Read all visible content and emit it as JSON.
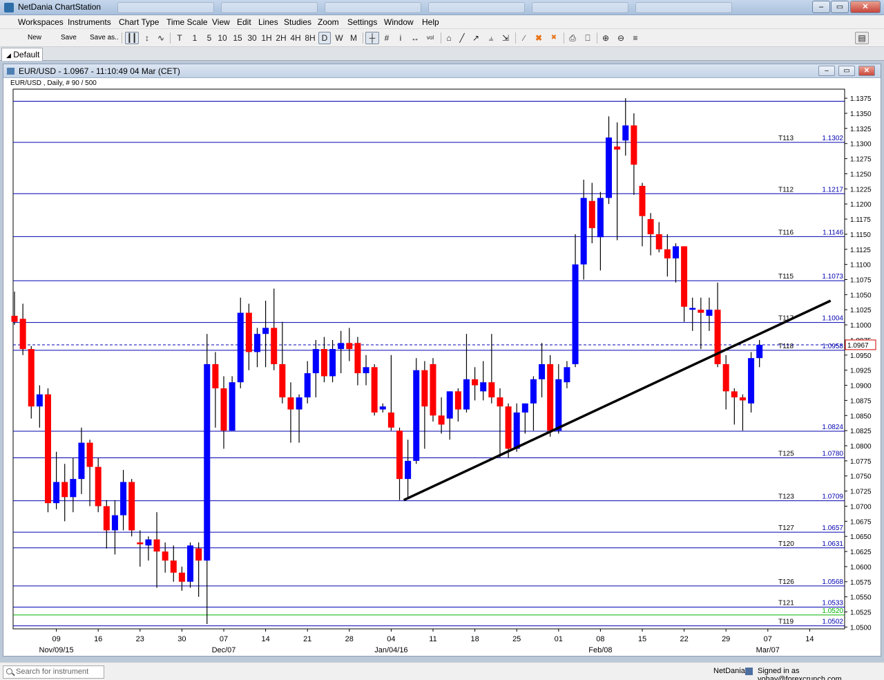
{
  "window": {
    "title": "NetDania ChartStation",
    "buttons": {
      "minimize": "–",
      "maximize": "▭",
      "close": "✕"
    }
  },
  "menu": [
    "Workspaces",
    "Instruments",
    "Chart Type",
    "Time Scale",
    "View",
    "Edit",
    "Lines",
    "Studies",
    "Zoom",
    "Settings",
    "Window",
    "Help"
  ],
  "toolbar": {
    "new_label": "New",
    "save_label": "Save",
    "save_as_label": "Save as..",
    "timescales": [
      "T",
      "1",
      "5",
      "10",
      "15",
      "30",
      "1H",
      "2H",
      "4H",
      "8H",
      "D",
      "W",
      "M"
    ],
    "active_timescale": "D"
  },
  "tabs": {
    "default_label": "Default"
  },
  "chart_window": {
    "title": "EUR/USD - 1.0967 - 11:10:49  04 Mar (CET)",
    "subinfo": "EUR/USD , Daily, # 90 / 500"
  },
  "chart_data": {
    "type": "candlestick",
    "instrument": "EUR/USD",
    "ylim": [
      1.0497,
      1.139
    ],
    "y_ticks": [
      1.05,
      1.0525,
      1.055,
      1.0575,
      1.06,
      1.0625,
      1.065,
      1.0675,
      1.07,
      1.0725,
      1.075,
      1.0775,
      1.08,
      1.0825,
      1.085,
      1.0875,
      1.09,
      1.0925,
      1.095,
      1.0975,
      1.1,
      1.1025,
      1.105,
      1.1075,
      1.11,
      1.1125,
      1.115,
      1.1175,
      1.12,
      1.1225,
      1.125,
      1.1275,
      1.13,
      1.1325,
      1.135,
      1.1375
    ],
    "x_labels": [
      {
        "label": "09",
        "index": 5
      },
      {
        "label": "Nov/09/15",
        "index": 5
      },
      {
        "label": "16",
        "index": 10
      },
      {
        "label": "23",
        "index": 15
      },
      {
        "label": "30",
        "index": 20
      },
      {
        "label": "07",
        "index": 25
      },
      {
        "label": "Dec/07",
        "index": 25
      },
      {
        "label": "14",
        "index": 30
      },
      {
        "label": "21",
        "index": 35
      },
      {
        "label": "28",
        "index": 40
      },
      {
        "label": "04",
        "index": 45
      },
      {
        "label": "Jan/04/16",
        "index": 45
      },
      {
        "label": "11",
        "index": 50
      },
      {
        "label": "18",
        "index": 55
      },
      {
        "label": "25",
        "index": 60
      },
      {
        "label": "01",
        "index": 65
      },
      {
        "label": "08",
        "index": 70
      },
      {
        "label": "Feb/08",
        "index": 70
      },
      {
        "label": "15",
        "index": 75
      },
      {
        "label": "22",
        "index": 80
      },
      {
        "label": "29",
        "index": 85
      },
      {
        "label": "07",
        "index": 90
      },
      {
        "label": "Mar/07",
        "index": 90
      },
      {
        "label": "14",
        "index": 95
      }
    ],
    "candles": [
      [
        1.1015,
        1.1055,
        1.1,
        1.1005
      ],
      [
        1.101,
        1.1035,
        1.095,
        1.096
      ],
      [
        1.096,
        1.0965,
        1.0845,
        1.0865
      ],
      [
        1.0865,
        1.09,
        1.083,
        1.0885
      ],
      [
        1.0885,
        1.0895,
        1.069,
        1.0705
      ],
      [
        1.0705,
        1.079,
        1.0695,
        1.074
      ],
      [
        1.074,
        1.077,
        1.0675,
        1.0715
      ],
      [
        1.0715,
        1.078,
        1.069,
        1.0745
      ],
      [
        1.0745,
        1.083,
        1.072,
        1.0805
      ],
      [
        1.0805,
        1.081,
        1.07,
        1.0765
      ],
      [
        1.0765,
        1.078,
        1.069,
        1.07
      ],
      [
        1.07,
        1.071,
        1.063,
        1.066
      ],
      [
        1.066,
        1.071,
        1.062,
        1.0685
      ],
      [
        1.0685,
        1.076,
        1.066,
        1.074
      ],
      [
        1.074,
        1.0745,
        1.065,
        1.066
      ],
      [
        1.064,
        1.066,
        1.06,
        1.0637
      ],
      [
        1.0635,
        1.065,
        1.061,
        1.0645
      ],
      [
        1.0645,
        1.069,
        1.0565,
        1.0625
      ],
      [
        1.0625,
        1.064,
        1.059,
        1.061
      ],
      [
        1.061,
        1.0635,
        1.0575,
        1.059
      ],
      [
        1.059,
        1.06,
        1.056,
        1.0575
      ],
      [
        1.0575,
        1.064,
        1.0565,
        1.0635
      ],
      [
        1.063,
        1.064,
        1.055,
        1.061
      ],
      [
        1.061,
        1.0985,
        1.0505,
        1.0935
      ],
      [
        1.0935,
        1.0955,
        1.083,
        1.0895
      ],
      [
        1.0895,
        1.0915,
        1.0795,
        1.0825
      ],
      [
        1.0825,
        1.0915,
        1.0825,
        1.0905
      ],
      [
        1.0905,
        1.1045,
        1.0895,
        1.102
      ],
      [
        1.102,
        1.1035,
        1.0925,
        1.0955
      ],
      [
        1.0955,
        1.0995,
        1.093,
        1.0985
      ],
      [
        1.0985,
        1.104,
        1.093,
        1.0995
      ],
      [
        1.0995,
        1.106,
        1.0925,
        1.0935
      ],
      [
        1.0935,
        1.1005,
        1.087,
        1.088
      ],
      [
        1.088,
        1.0905,
        1.0805,
        1.086
      ],
      [
        1.086,
        1.0885,
        1.0805,
        1.088
      ],
      [
        1.088,
        1.094,
        1.087,
        1.092
      ],
      [
        1.092,
        1.0975,
        1.088,
        1.096
      ],
      [
        1.096,
        1.098,
        1.0905,
        1.0915
      ],
      [
        1.0915,
        1.0975,
        1.0905,
        1.096
      ],
      [
        1.096,
        1.099,
        1.092,
        1.097
      ],
      [
        1.097,
        1.0995,
        1.094,
        1.096
      ],
      [
        1.097,
        1.098,
        1.09,
        1.092
      ],
      [
        1.092,
        1.095,
        1.09,
        1.093
      ],
      [
        1.093,
        1.0935,
        1.085,
        1.0855
      ],
      [
        1.086,
        1.087,
        1.0855,
        1.0865
      ],
      [
        1.0855,
        1.095,
        1.0825,
        1.083
      ],
      [
        1.0825,
        1.083,
        1.071,
        1.0745
      ],
      [
        1.0745,
        1.081,
        1.0715,
        1.0775
      ],
      [
        1.0775,
        1.0945,
        1.077,
        1.0925
      ],
      [
        1.0925,
        1.094,
        1.0795,
        1.0865
      ],
      [
        1.0935,
        1.0945,
        1.084,
        1.085
      ],
      [
        1.085,
        1.088,
        1.082,
        1.0835
      ],
      [
        1.0845,
        1.089,
        1.081,
        1.089
      ],
      [
        1.089,
        1.0895,
        1.084,
        1.086
      ],
      [
        1.086,
        1.0985,
        1.0855,
        1.091
      ],
      [
        1.091,
        1.093,
        1.0875,
        1.09
      ],
      [
        1.089,
        1.094,
        1.0875,
        1.0905
      ],
      [
        1.0905,
        1.0985,
        1.087,
        1.088
      ],
      [
        1.088,
        1.0895,
        1.078,
        1.0865
      ],
      [
        1.0865,
        1.087,
        1.078,
        1.0795
      ],
      [
        1.0795,
        1.087,
        1.079,
        1.0855
      ],
      [
        1.0855,
        1.087,
        1.082,
        1.087
      ],
      [
        1.087,
        1.0915,
        1.0825,
        1.091
      ],
      [
        1.091,
        1.097,
        1.088,
        1.0935
      ],
      [
        1.0935,
        1.095,
        1.0815,
        1.0825
      ],
      [
        1.0825,
        1.0935,
        1.082,
        1.091
      ],
      [
        1.0905,
        1.094,
        1.0895,
        1.093
      ],
      [
        1.0935,
        1.115,
        1.093,
        1.11
      ],
      [
        1.11,
        1.124,
        1.1075,
        1.121
      ],
      [
        1.1205,
        1.1235,
        1.1135,
        1.116
      ],
      [
        1.1145,
        1.122,
        1.109,
        1.121
      ],
      [
        1.121,
        1.1345,
        1.12,
        1.131
      ],
      [
        1.1295,
        1.1335,
        1.114,
        1.129
      ],
      [
        1.1305,
        1.1375,
        1.128,
        1.133
      ],
      [
        1.133,
        1.135,
        1.1215,
        1.1265
      ],
      [
        1.123,
        1.1235,
        1.113,
        1.118
      ],
      [
        1.1175,
        1.1185,
        1.1115,
        1.115
      ],
      [
        1.115,
        1.117,
        1.112,
        1.1125
      ],
      [
        1.1125,
        1.115,
        1.108,
        1.111
      ],
      [
        1.111,
        1.1135,
        1.107,
        1.113
      ],
      [
        1.113,
        1.113,
        1.1005,
        1.103
      ],
      [
        1.1025,
        1.1045,
        1.099,
        1.1028
      ],
      [
        1.1025,
        1.1045,
        1.096,
        1.102
      ],
      [
        1.1015,
        1.1045,
        1.099,
        1.1025
      ],
      [
        1.1025,
        1.107,
        1.093,
        1.0935
      ],
      [
        1.0935,
        1.095,
        1.086,
        1.089
      ],
      [
        1.089,
        1.0895,
        1.0835,
        1.088
      ],
      [
        1.088,
        1.0885,
        1.0825,
        1.0875
      ],
      [
        1.087,
        1.0955,
        1.0855,
        1.0945
      ],
      [
        1.0945,
        1.0975,
        1.093,
        1.0967
      ]
    ],
    "colors": {
      "up": "#0000ff",
      "down": "#ff0000",
      "line": "#0000b0",
      "green_line": "#00b000",
      "trend": "#000000",
      "price_box": "#cc0000"
    },
    "hlines": [
      {
        "value": 1.137,
        "label": "",
        "price": ""
      },
      {
        "value": 1.1302,
        "label": "T113",
        "price": "1.1302"
      },
      {
        "value": 1.1217,
        "label": "T112",
        "price": "1.1217"
      },
      {
        "value": 1.1146,
        "label": "T116",
        "price": "1.1146"
      },
      {
        "value": 1.1073,
        "label": "T115",
        "price": "1.1073"
      },
      {
        "value": 1.1004,
        "label": "T117",
        "price": "1.1004"
      },
      {
        "value": 1.0958,
        "label": "T118",
        "price": "1.0958"
      },
      {
        "value": 1.0824,
        "label": "",
        "price": "1.0824"
      },
      {
        "value": 1.078,
        "label": "T125",
        "price": "1.0780"
      },
      {
        "value": 1.0709,
        "label": "T123",
        "price": "1.0709"
      },
      {
        "value": 1.0657,
        "label": "T127",
        "price": "1.0657"
      },
      {
        "value": 1.0631,
        "label": "T120",
        "price": "1.0631"
      },
      {
        "value": 1.0568,
        "label": "T126",
        "price": "1.0568"
      },
      {
        "value": 1.0533,
        "label": "T121",
        "price": "1.0533"
      },
      {
        "value": 1.0502,
        "label": "T119",
        "price": "1.0502"
      }
    ],
    "green_line": {
      "value": 1.052,
      "price": "1.0520"
    },
    "current_price": {
      "value": 1.0967,
      "label": "1.0967"
    },
    "trendline": {
      "from": {
        "index": 46.5,
        "value": 1.071
      },
      "to": {
        "index": 97.5,
        "value": 1.104
      }
    }
  },
  "status": {
    "search_placeholder": "Search for instrument",
    "brand": "NetDania",
    "signed_in": "Signed in as yohay@forexcrunch.com"
  }
}
